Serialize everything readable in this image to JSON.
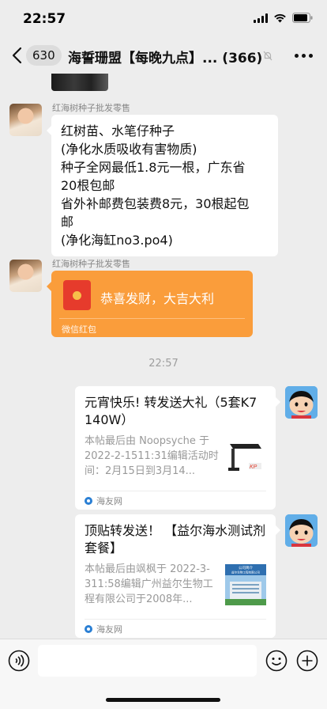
{
  "status_bar": {
    "time": "22:57"
  },
  "nav": {
    "back_label": "",
    "unread_count": "630",
    "title": "海誓珊盟【每晚九点】...",
    "member_count": "(366)"
  },
  "messages": [
    {
      "type": "text",
      "sender": "红海树种子批发零售",
      "lines": [
        "红树苗、水笔仔种子",
        "(净化水质吸收有害物质)",
        "种子全网最低1.8元一根，广东省",
        "20根包邮",
        "省外补邮费包装费8元，30根起包",
        "邮",
        "(净化海缸no3.po4)"
      ]
    },
    {
      "type": "red_packet",
      "sender": "红海树种子批发零售",
      "text": "恭喜发财，大吉大利",
      "footer": "微信红包"
    }
  ],
  "time_divider": "22:57",
  "link_cards": [
    {
      "title": "元宵快乐! 转发送大礼（5套K7  140W）",
      "desc": "本帖最后由 Noopsyche 于 2022-2-1511:31编辑活动时间：2月15日到3月14...",
      "source": "海友网",
      "thumb": "lamp"
    },
    {
      "title": "顶贴转发送！ 【益尔海水测试剂套餐】",
      "desc": "本帖最后由飒枫于 2022-3-311:58编辑广州益尔生物工程有限公司于2008年...",
      "source": "海友网",
      "thumb": "building",
      "thumb_caption": "公司简介\n益尔生物工程有限公司"
    }
  ],
  "input": {
    "value": ""
  },
  "colors": {
    "background": "#ededed",
    "red_packet": "#fa9d3b",
    "bubble": "#ffffff",
    "muted_text": "#888888"
  }
}
